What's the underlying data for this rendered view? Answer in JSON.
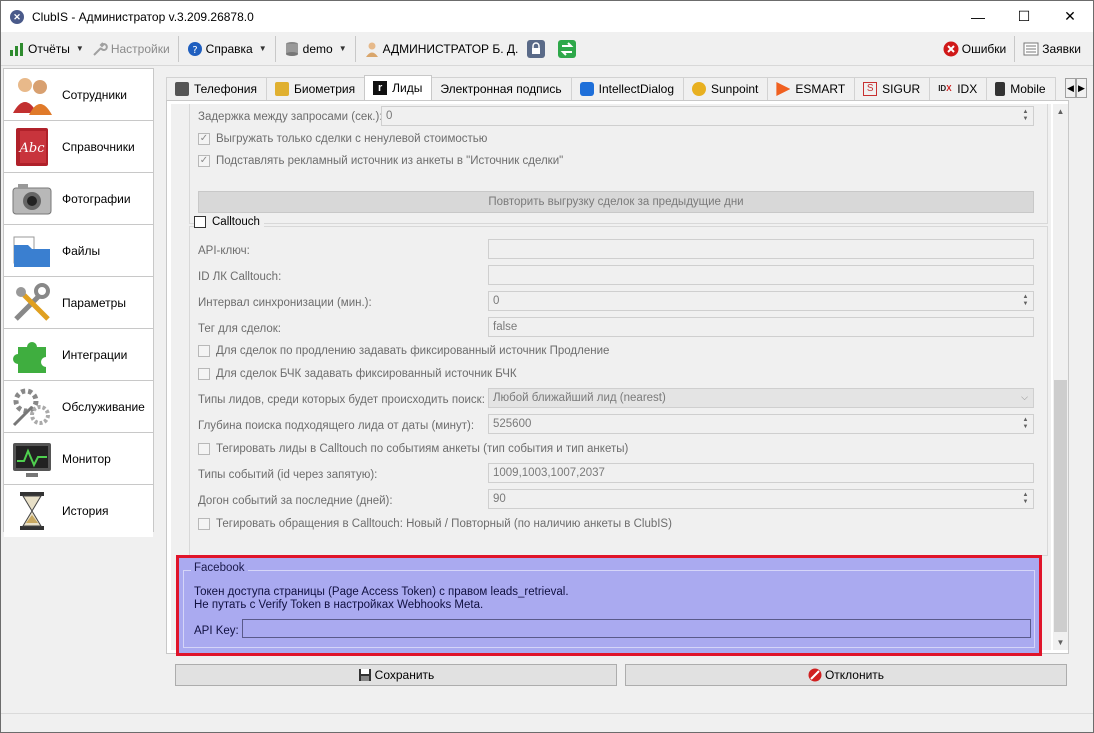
{
  "window": {
    "title": "ClubIS - Администратор v.3.209.26878.0",
    "app_icon": "clubis-logo-icon",
    "min": "—",
    "max": "☐",
    "close": "✕"
  },
  "toolbar": {
    "reports": "Отчёты",
    "settings": "Настройки",
    "help": "Справка",
    "db": "demo",
    "user": "АДМИНИСТРАТОР Б. Д.",
    "errors": "Ошибки",
    "requests": "Заявки"
  },
  "sidebar": {
    "items": [
      {
        "label": "Сотрудники",
        "icon": "people-icon"
      },
      {
        "label": "Справочники",
        "icon": "book-icon"
      },
      {
        "label": "Фотографии",
        "icon": "camera-icon"
      },
      {
        "label": "Файлы",
        "icon": "folder-icon"
      },
      {
        "label": "Параметры",
        "icon": "tools-icon"
      },
      {
        "label": "Интеграции",
        "icon": "puzzle-icon"
      },
      {
        "label": "Обслуживание",
        "icon": "gears-icon"
      },
      {
        "label": "Монитор",
        "icon": "monitor-icon"
      },
      {
        "label": "История",
        "icon": "hourglass-icon"
      }
    ]
  },
  "tabs": [
    "Телефония",
    "Биометрия",
    "Лиды",
    "Электронная подпись",
    "IntellectDialog",
    "Sunpoint",
    "ESMART",
    "SIGUR",
    "IDX",
    "Mobile"
  ],
  "active_tab": "Лиды",
  "form": {
    "delay_label": "Задержка между запросами (сек.):",
    "delay_value": "0",
    "only_nonzero": "Выгружать только сделки с ненулевой стоимостью",
    "ad_source": "Подставлять рекламный источник из анкеты в \"Источник сделки\"",
    "repeat_btn": "Повторить выгрузку сделок за предыдущие дни",
    "calltouch_title": "Calltouch",
    "api_key_label": "API-ключ:",
    "api_key_value": "",
    "lk_id_label": "ID ЛК Calltouch:",
    "lk_id_value": "",
    "sync_label": "Интервал синхронизации (мин.):",
    "sync_value": "0",
    "tag_label": "Тег для сделок:",
    "tag_value": "false",
    "renew_chk": "Для сделок по продлению задавать фиксированный источник Продление",
    "bchk_chk": "Для сделок БЧК задавать фиксированный источник БЧК",
    "lead_types_label": "Типы лидов, среди которых будет происходить поиск:",
    "lead_types_value": "Любой ближайший лид (nearest)",
    "depth_label": "Глубина поиска подходящего лида от даты (минут):",
    "depth_value": "525600",
    "tag_leads_chk": "Тегировать лиды в Calltouch по событиям анкеты (тип события и тип анкеты)",
    "event_types_label": "Типы событий (id через запятую):",
    "event_types_value": "1009,1003,1007,2037",
    "catchup_label": "Догон событий за последние (дней):",
    "catchup_value": "90",
    "tag_requests_chk": "Тегировать обращения в Calltouch: Новый / Повторный (по наличию анкеты в ClubIS)"
  },
  "facebook": {
    "title": "Facebook",
    "line1": "Токен доступа страницы (Page Access Token) с правом leads_retrieval.",
    "line2": "Не путать с Verify Token в настройках Webhooks Meta.",
    "api_key_label": "API Key:",
    "api_key_value": ""
  },
  "buttons": {
    "save": "Сохранить",
    "cancel": "Отклонить"
  },
  "colors": {
    "highlight_border": "#e0142a",
    "highlight_fill": "#aaaaf0"
  }
}
